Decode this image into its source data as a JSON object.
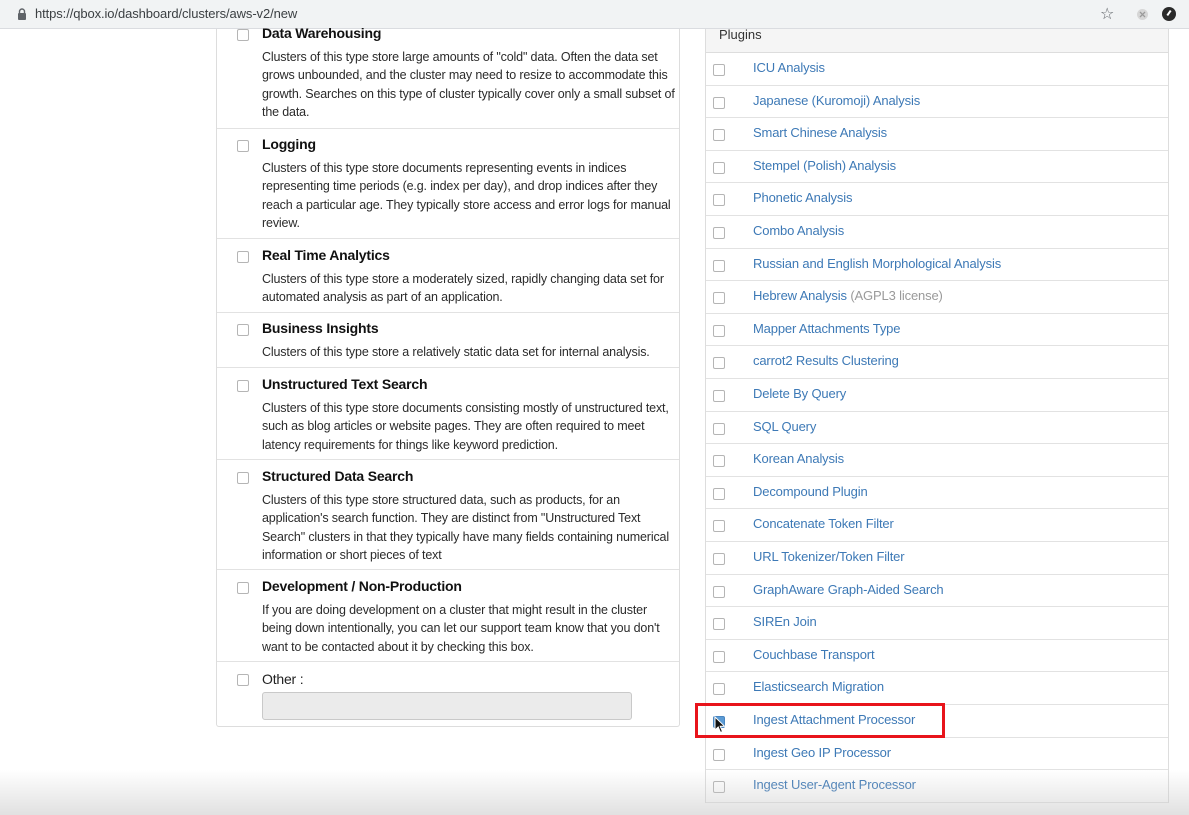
{
  "browser": {
    "url": "https://qbox.io/dashboard/clusters/aws-v2/new"
  },
  "cluster_types": [
    {
      "label": "Data Warehousing",
      "description": "Clusters of this type store large amounts of \"cold\" data. Often the data set grows unbounded, and the cluster may need to resize to accommodate this growth. Searches on this type of cluster typically cover only a small subset of the data."
    },
    {
      "label": "Logging",
      "description": "Clusters of this type store documents representing events in indices representing time periods (e.g. index per day), and drop indices after they reach a particular age. They typically store access and error logs for manual review."
    },
    {
      "label": "Real Time Analytics",
      "description": "Clusters of this type store a moderately sized, rapidly changing data set for automated analysis as part of an application."
    },
    {
      "label": "Business Insights",
      "description": "Clusters of this type store a relatively static data set for internal analysis."
    },
    {
      "label": "Unstructured Text Search",
      "description": "Clusters of this type store documents consisting mostly of unstructured text, such as blog articles or website pages. They are often required to meet latency requirements for things like keyword prediction."
    },
    {
      "label": "Structured Data Search",
      "description": "Clusters of this type store structured data, such as products, for an application's search function. They are distinct from \"Unstructured Text Search\" clusters in that they typically have many fields containing numerical information or short pieces of text"
    },
    {
      "label": "Development / Non-Production",
      "description": "If you are doing development on a cluster that might result in the cluster being down intentionally, you can let our support team know that you don't want to be contacted about it by checking this box."
    },
    {
      "label": "Other :",
      "input_value": ""
    }
  ],
  "plugins": {
    "header": "Plugins",
    "items": [
      {
        "label": "ICU Analysis",
        "checked": false
      },
      {
        "label": "Japanese (Kuromoji) Analysis",
        "checked": false
      },
      {
        "label": "Smart Chinese Analysis",
        "checked": false
      },
      {
        "label": "Stempel (Polish) Analysis",
        "checked": false
      },
      {
        "label": "Phonetic Analysis",
        "checked": false
      },
      {
        "label": "Combo Analysis",
        "checked": false
      },
      {
        "label": "Russian and English Morphological Analysis",
        "checked": false
      },
      {
        "label": "Hebrew Analysis",
        "note": "(AGPL3 license)",
        "checked": false
      },
      {
        "label": "Mapper Attachments Type",
        "checked": false
      },
      {
        "label": "carrot2 Results Clustering",
        "checked": false
      },
      {
        "label": "Delete By Query",
        "checked": false
      },
      {
        "label": "SQL Query",
        "checked": false
      },
      {
        "label": "Korean Analysis",
        "checked": false
      },
      {
        "label": "Decompound Plugin",
        "checked": false
      },
      {
        "label": "Concatenate Token Filter",
        "checked": false
      },
      {
        "label": "URL Tokenizer/Token Filter",
        "checked": false
      },
      {
        "label": "GraphAware Graph-Aided Search",
        "checked": false
      },
      {
        "label": "SIREn Join",
        "checked": false
      },
      {
        "label": "Couchbase Transport",
        "checked": false
      },
      {
        "label": "Elasticsearch Migration",
        "checked": false
      },
      {
        "label": "Ingest Attachment Processor",
        "checked": true
      },
      {
        "label": "Ingest Geo IP Processor",
        "checked": false
      },
      {
        "label": "Ingest User-Agent Processor",
        "checked": false
      }
    ]
  },
  "colors": {
    "link": "#3d79b6",
    "highlight": "#e8141b",
    "checked": "#5b9bd5"
  }
}
